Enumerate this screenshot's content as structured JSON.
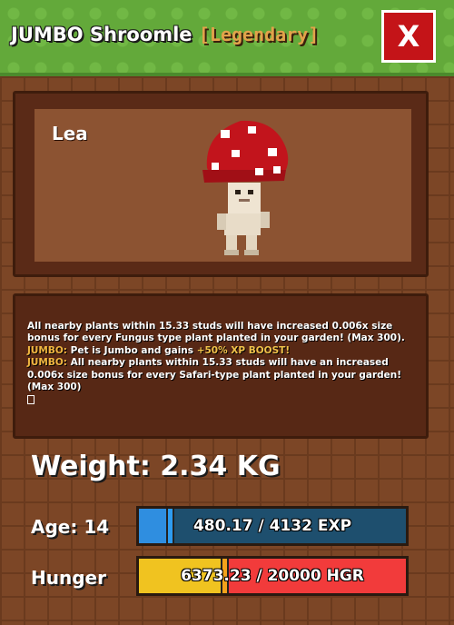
{
  "header": {
    "title": "JUMBO Shroomle",
    "rarity": "[Legendary]",
    "close_label": "X"
  },
  "pet": {
    "name": "Lea"
  },
  "description": {
    "line1": "All nearby plants within 15.33 studs will have increased 0.006x size bonus for every Fungus type plant planted in your garden! (Max 300).",
    "jumbo_tag_1": "JUMBO:",
    "jumbo_text_1": "Pet is Jumbo and gains",
    "boost_text": "+50% XP BOOST!",
    "jumbo_tag_2": "JUMBO:",
    "jumbo_text_2": "All nearby plants within 15.33 studs will have an increased 0.006x size bonus for every Safari-type plant planted in your garden! (Max 300)"
  },
  "stats": {
    "weight_text": "Weight: 2.34 KG",
    "age_label": "Age: 14",
    "exp_text": "480.17 / 4132 EXP",
    "exp_fraction": 0.116,
    "hunger_label": "Hunger",
    "hunger_text": "6373.23 / 20000 HGR",
    "hunger_fraction": 0.319
  },
  "colors": {
    "exp_fill": "#2f8ee0",
    "exp_empty": "#1e4f6e",
    "hunger_fill": "#f0c320",
    "hunger_empty": "#f23b3b",
    "knob": "#f3a21b",
    "exp_knob": "#2e9cf0"
  }
}
